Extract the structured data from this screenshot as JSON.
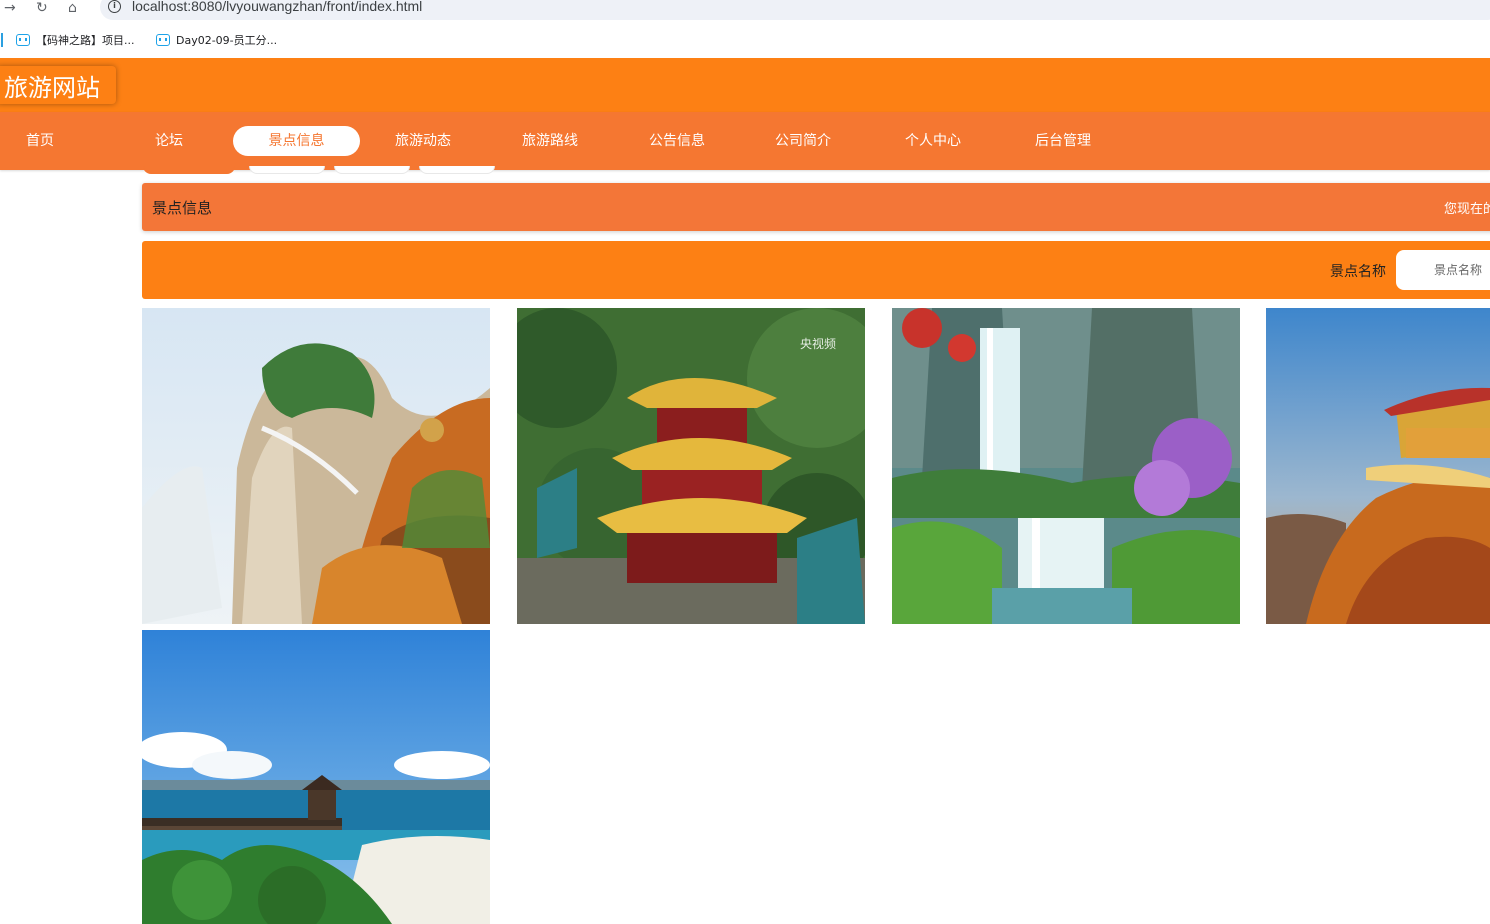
{
  "browser": {
    "url": "localhost:8080/lvyouwangzhan/front/index.html",
    "bookmarks": [
      {
        "label": "【码神之路】项目..."
      },
      {
        "label": "Day02-09-员工分..."
      }
    ]
  },
  "site": {
    "logo": "旅游网站"
  },
  "nav": {
    "items": [
      {
        "label": "首页"
      },
      {
        "label": "论坛"
      },
      {
        "label": "景点信息",
        "active": true
      },
      {
        "label": "旅游动态"
      },
      {
        "label": "旅游路线"
      },
      {
        "label": "公告信息"
      },
      {
        "label": "公司简介"
      },
      {
        "label": "个人中心"
      },
      {
        "label": "后台管理"
      }
    ]
  },
  "breadcrumb": {
    "title": "景点信息",
    "right_text": "您现在的位置"
  },
  "search": {
    "label": "景点名称",
    "placeholder": "景点名称"
  },
  "cards": [
    {
      "icon": "mountain-cliff-photo"
    },
    {
      "icon": "pavilion-tower-photo",
      "watermark": "央视频"
    },
    {
      "icon": "waterfall-photo"
    },
    {
      "icon": "cliff-temple-photo"
    },
    {
      "icon": "seaside-pavilion-photo"
    }
  ],
  "colors": {
    "header_orange": "#fd8014",
    "nav_orange": "#f57731",
    "crumb_orange": "#f37638"
  }
}
